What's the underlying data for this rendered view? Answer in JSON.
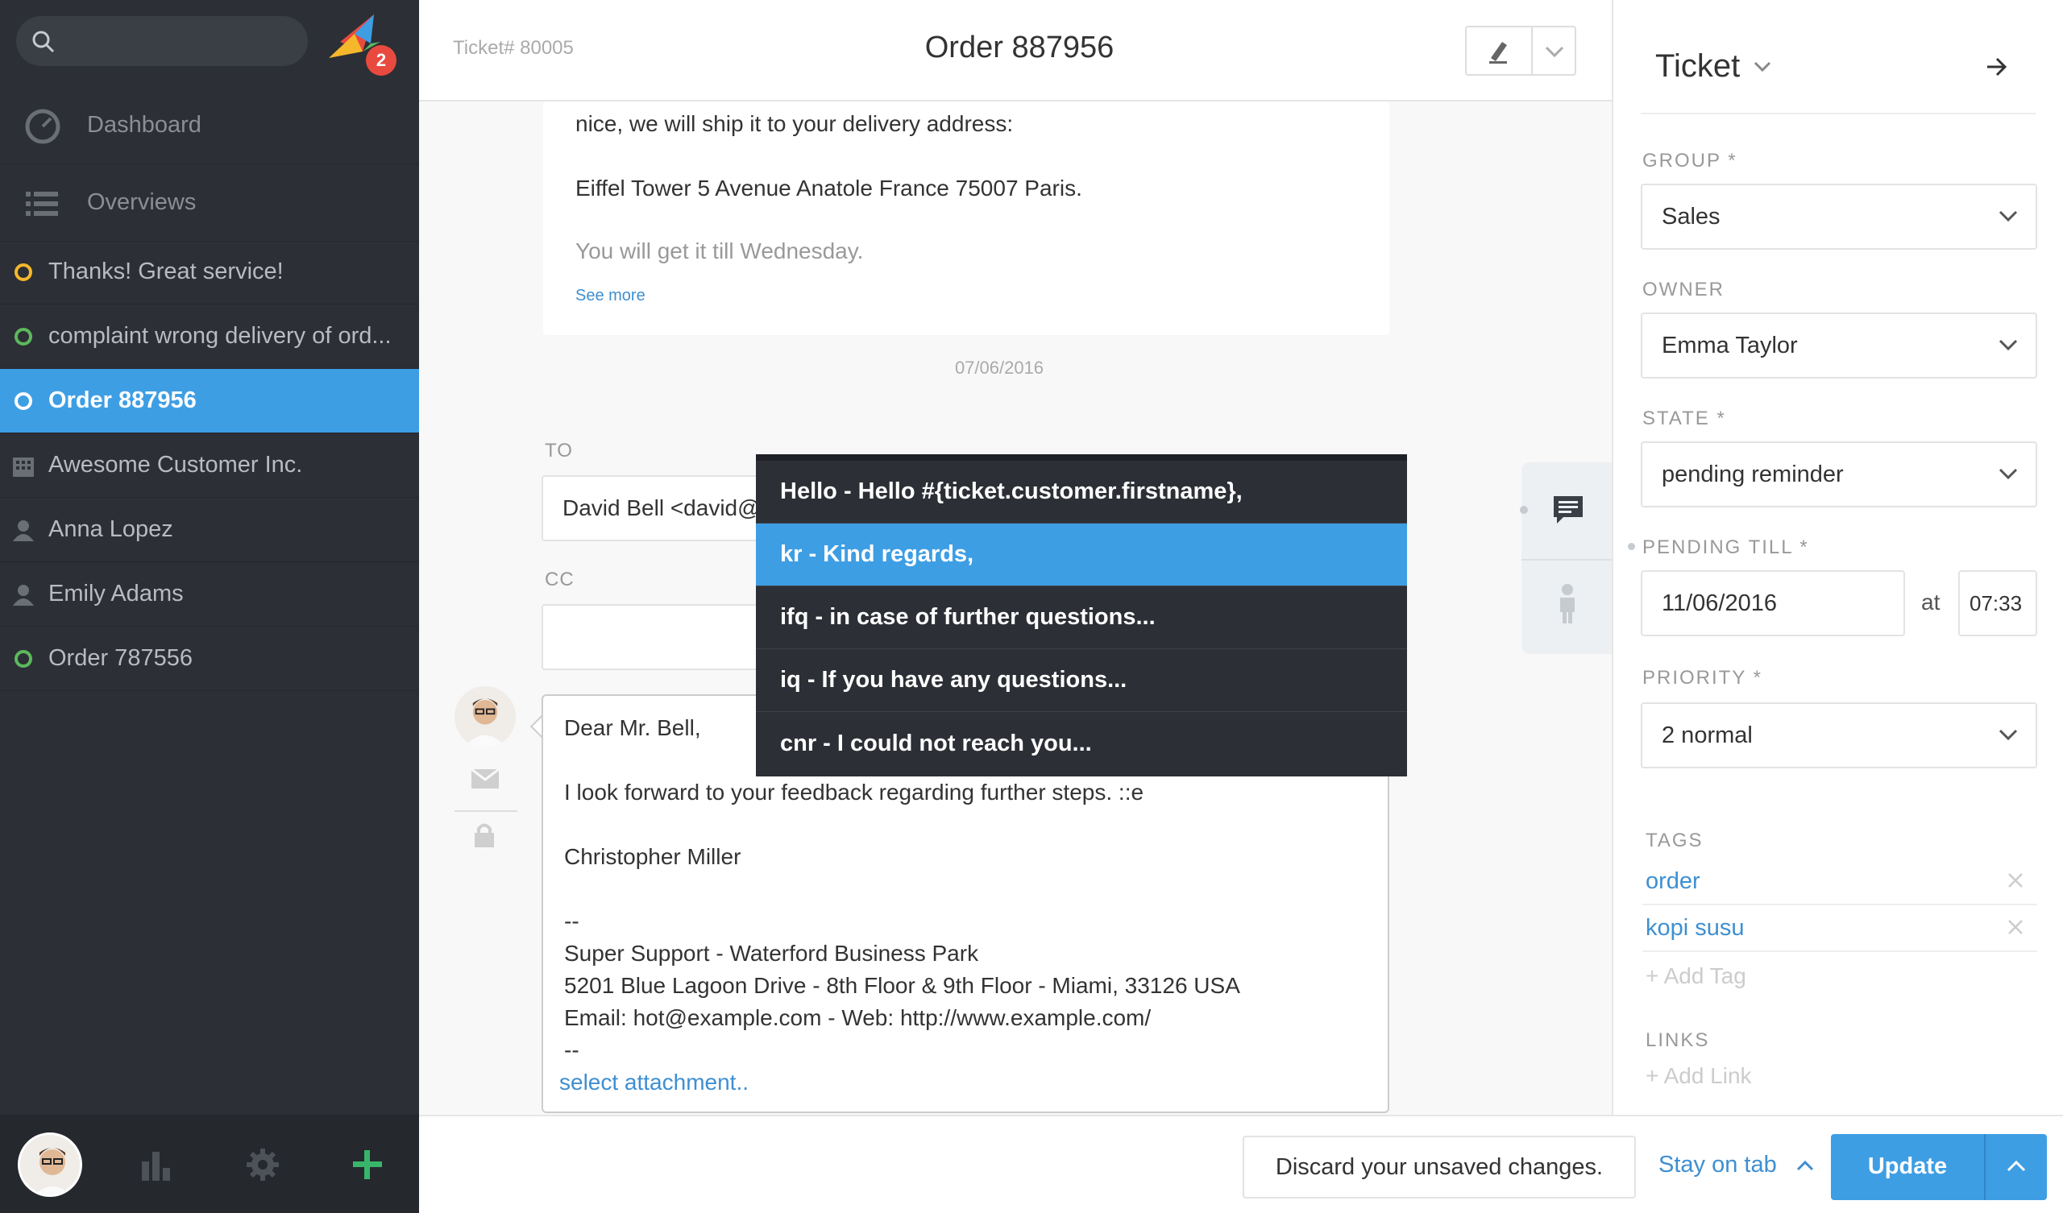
{
  "sidebar": {
    "search_placeholder": "",
    "logo_badge": "2",
    "nav": [
      {
        "label": "Dashboard",
        "icon": "dashboard-icon"
      },
      {
        "label": "Overviews",
        "icon": "list-icon"
      }
    ],
    "tabs": [
      {
        "label": "Thanks! Great service!",
        "icon": "status-circle-icon",
        "color": "#f5b72b"
      },
      {
        "label": "complaint wrong delivery of ord...",
        "icon": "status-circle-icon",
        "color": "#5cb85c"
      },
      {
        "label": "Order 887956",
        "icon": "status-circle-icon",
        "color": "#ffffff"
      },
      {
        "label": "Awesome Customer Inc.",
        "icon": "building-icon",
        "color": "#8b8e94"
      },
      {
        "label": "Anna Lopez",
        "icon": "person-icon",
        "color": "#8b8e94"
      },
      {
        "label": "Emily Adams",
        "icon": "person-icon",
        "color": "#8b8e94"
      },
      {
        "label": "Order 787556",
        "icon": "status-circle-icon",
        "color": "#5cb85c"
      }
    ]
  },
  "header": {
    "ticket_number": "Ticket# 80005",
    "title": "Order 887956"
  },
  "article": {
    "lines": [
      "nice, we will ship it to your delivery address:",
      "Eiffel Tower 5 Avenue Anatole France 75007 Paris.",
      "You will get it till Wednesday."
    ],
    "see_more": "See more",
    "date": "07/06/2016"
  },
  "reply": {
    "to_label": "TO",
    "to_value": "David Bell <david@",
    "cc_label": "CC",
    "cc_value": "",
    "body": [
      "Dear Mr. Bell,",
      "I look forward to your feedback regarding further steps. ::e",
      "Christopher Miller",
      "--",
      "Super Support - Waterford Business Park",
      "5201 Blue Lagoon Drive - 8th Floor & 9th Floor - Miami, 33126 USA",
      "Email: hot@example.com - Web: http://www.example.com/",
      "--"
    ],
    "attachment": "select attachment.."
  },
  "dropdown": {
    "items": [
      "Hello - Hello #{ticket.customer.firstname},",
      "kr - Kind regards,",
      "ifq - in case of further questions...",
      "iq - If you have any questions...",
      "cnr - I could not reach you..."
    ],
    "selected_index": 1
  },
  "panel": {
    "title": "Ticket",
    "group_label": "GROUP *",
    "group_value": "Sales",
    "owner_label": "OWNER",
    "owner_value": "Emma Taylor",
    "state_label": "STATE *",
    "state_value": "pending reminder",
    "pending_label": "PENDING TILL *",
    "pending_date": "11/06/2016",
    "pending_at": "at",
    "pending_time": "07:33",
    "priority_label": "PRIORITY *",
    "priority_value": "2 normal",
    "tags_label": "TAGS",
    "tags": [
      "order",
      "kopi susu"
    ],
    "add_tag": "+ Add Tag",
    "links_label": "LINKS",
    "add_link": "+ Add Link"
  },
  "footer": {
    "discard": "Discard your unsaved changes.",
    "stay_on_tab": "Stay on tab",
    "update": "Update"
  },
  "colors": {
    "accent": "#3e9ee4",
    "sidebar_bg": "#2c2f35",
    "link": "#3e8fd1",
    "add_button": "#38b56a"
  }
}
